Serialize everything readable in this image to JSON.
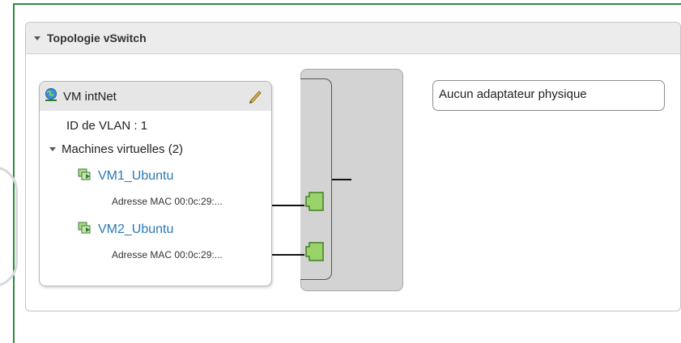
{
  "panel": {
    "title": "Topologie vSwitch"
  },
  "port_group": {
    "name": "VM intNet",
    "vlan_label": "ID de VLAN : 1",
    "vms_header": "Machines virtuelles (2)",
    "vms": [
      {
        "name": "VM1_Ubuntu",
        "mac": "Adresse MAC 00:0c:29:..."
      },
      {
        "name": "VM2_Ubuntu",
        "mac": "Adresse MAC 00:0c:29:..."
      }
    ]
  },
  "physical_adapters": {
    "label": "Aucun adaptateur physique"
  },
  "icons": {
    "port_group": "network-globe-icon",
    "edit": "pencil-icon",
    "vm": "vm-icon",
    "port": "nic-port-icon"
  },
  "colors": {
    "frame": "#2e8b3d",
    "vm_link": "#2b78b8",
    "port_fill": "#9bd36b"
  }
}
